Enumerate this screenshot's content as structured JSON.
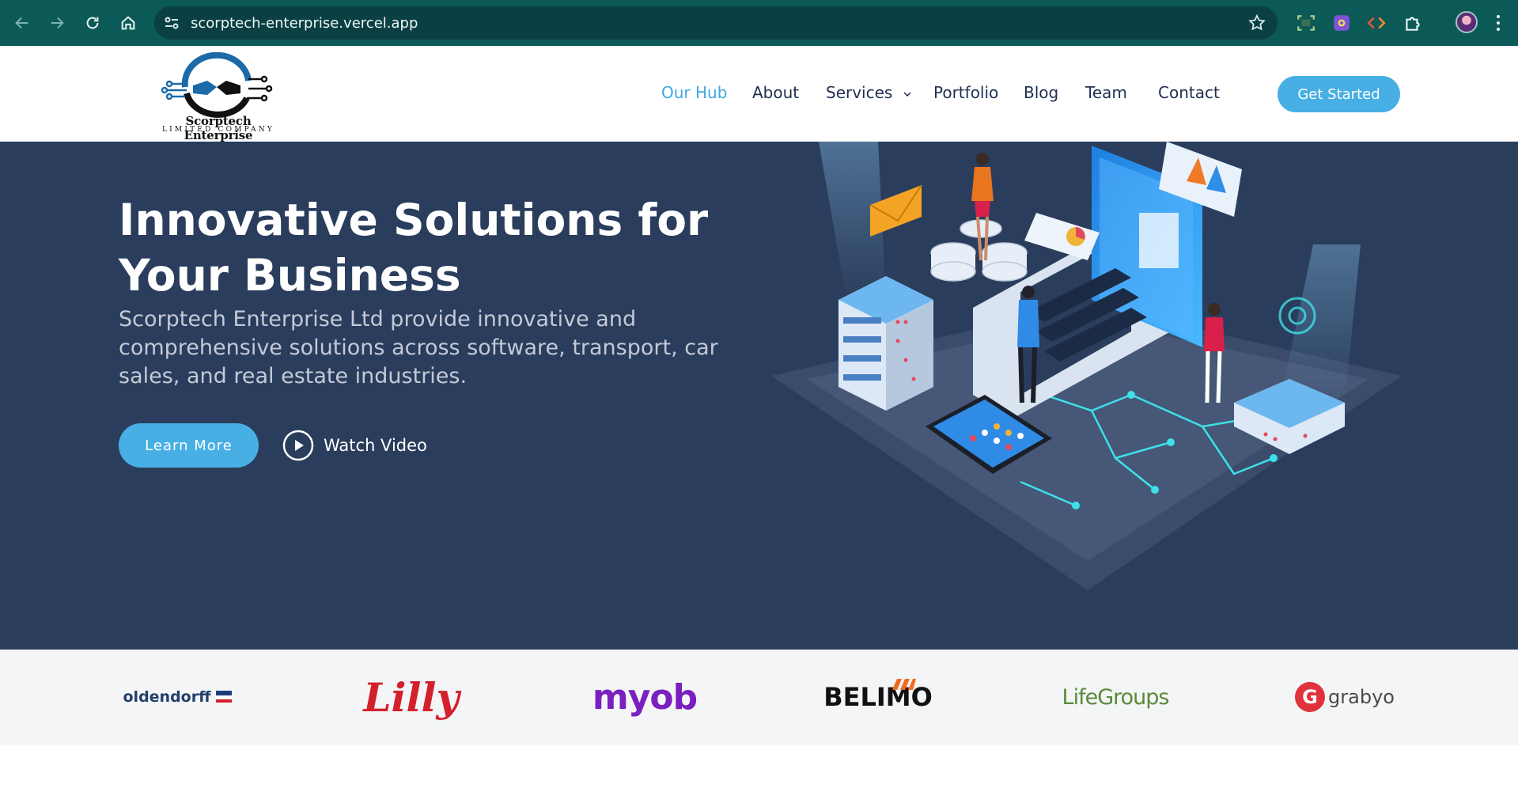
{
  "browser": {
    "url": "scorptech-enterprise.vercel.app",
    "icons": [
      "back-icon",
      "forward-icon",
      "reload-icon",
      "home-icon",
      "site-info-icon",
      "bookmark-star-icon",
      "screenshot-icon",
      "extension-icon",
      "devtools-icon",
      "puzzle-icon",
      "profile-avatar",
      "kebab-menu-icon"
    ]
  },
  "header": {
    "logo_name": "Scorptech Enterprise",
    "logo_sub": "LIMITED COMPANY",
    "nav": [
      {
        "label": "Our Hub",
        "active": true
      },
      {
        "label": "About"
      },
      {
        "label": "Services"
      },
      {
        "label": "Portfolio"
      },
      {
        "label": "Blog"
      },
      {
        "label": "Team"
      },
      {
        "label": "Contact"
      }
    ],
    "cta": "Get Started"
  },
  "hero": {
    "title": "Innovative Solutions for Your Business",
    "subtitle": "Scorptech Enterprise Ltd provide innovative and comprehensive solutions across software, transport, car sales, and real estate industries.",
    "primary_button": "Learn More",
    "video_button": "Watch Video"
  },
  "clients": [
    {
      "name": "oldendorff"
    },
    {
      "name": "Lilly"
    },
    {
      "name": "myob"
    },
    {
      "name": "BELIMO"
    },
    {
      "name": "LifeGroups"
    },
    {
      "name": "grabyo"
    }
  ],
  "colors": {
    "chrome": "#0c5a57",
    "omnibox": "#0a3f44",
    "accent": "#47afe4",
    "hero_bg": "#2b3d5c",
    "nav_text": "#1f2f4f"
  }
}
